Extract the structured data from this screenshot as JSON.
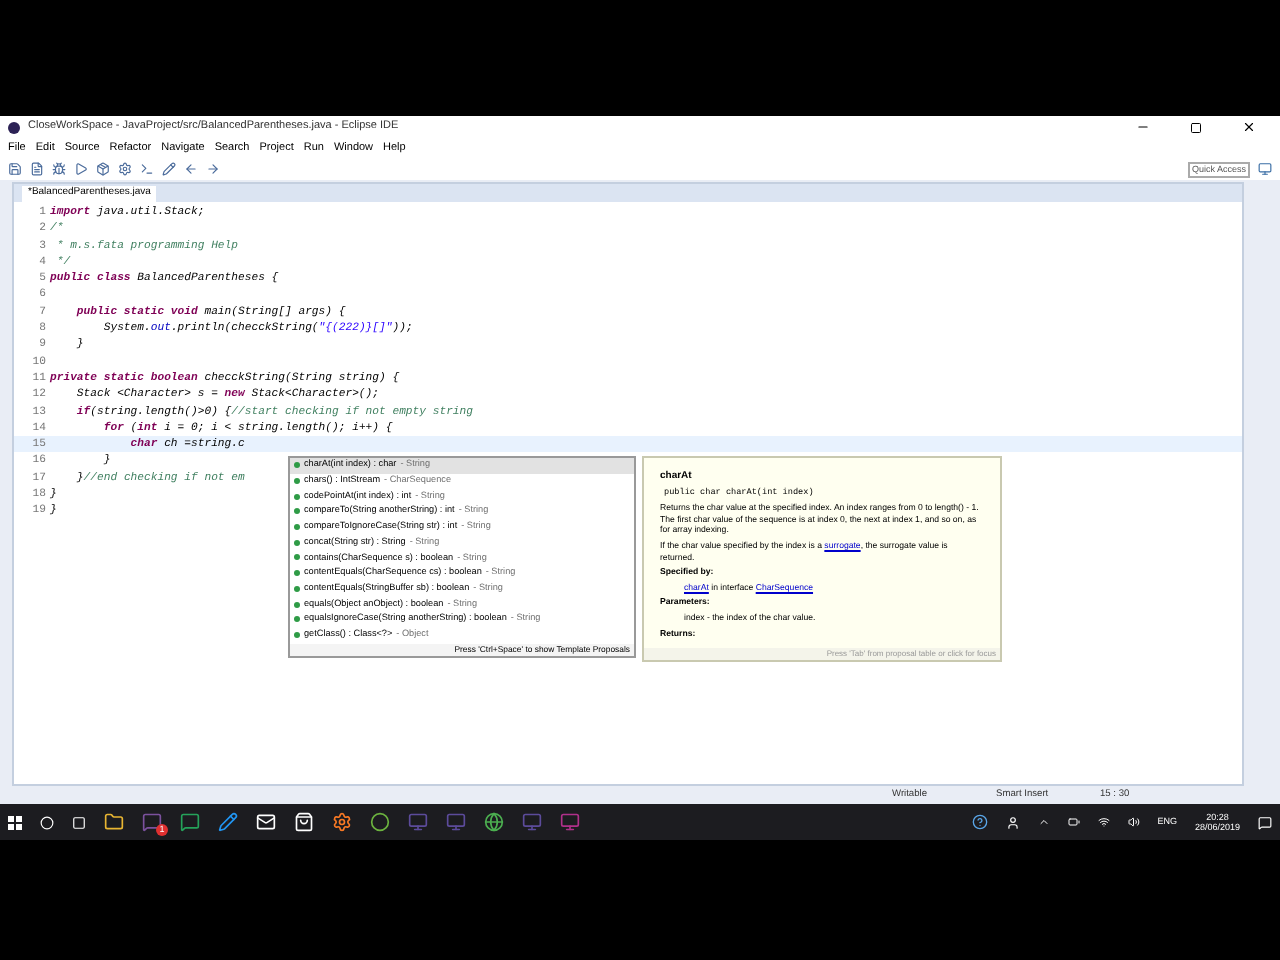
{
  "window": {
    "title": "CloseWorkSpace - JavaProject/src/BalancedParentheses.java - Eclipse IDE"
  },
  "menu": [
    "File",
    "Edit",
    "Source",
    "Refactor",
    "Navigate",
    "Search",
    "Project",
    "Run",
    "Window",
    "Help"
  ],
  "quick_access": {
    "placeholder": "Quick Access"
  },
  "editor_tab": {
    "label": "*BalancedParentheses.java",
    "selected": true
  },
  "code_lines": [
    {
      "number": "1",
      "current": false,
      "tokens": [
        {
          "kind": "keyword",
          "text": "import"
        },
        {
          "kind": "plain",
          "text": " java.util.Stack;"
        }
      ]
    },
    {
      "number": "2",
      "current": false,
      "tokens": [
        {
          "kind": "comment",
          "text": "/*"
        }
      ]
    },
    {
      "number": "3",
      "current": false,
      "tokens": [
        {
          "kind": "comment",
          "text": " * m.s.fata programming Help"
        }
      ]
    },
    {
      "number": "4",
      "current": false,
      "tokens": [
        {
          "kind": "comment",
          "text": " */"
        }
      ]
    },
    {
      "number": "5",
      "current": false,
      "tokens": [
        {
          "kind": "keyword",
          "text": "public class"
        },
        {
          "kind": "plain",
          "text": " BalancedParentheses {"
        }
      ]
    },
    {
      "number": "6",
      "current": false
    },
    {
      "number": "7",
      "current": false,
      "tokens": [
        {
          "kind": "keyword",
          "text": "    public static void"
        },
        {
          "kind": "plain",
          "text": " main(String[] args) {"
        }
      ]
    },
    {
      "number": "8",
      "current": false,
      "tokens": [
        {
          "kind": "plain",
          "text": "        System."
        },
        {
          "kind": "field",
          "text": "out"
        },
        {
          "kind": "plain",
          "text": ".println(checckString("
        },
        {
          "kind": "string",
          "text": "\"{(222)}[]\""
        },
        {
          "kind": "plain",
          "text": "));"
        }
      ]
    },
    {
      "number": "9",
      "current": false,
      "tokens": [
        {
          "kind": "plain",
          "text": "    }"
        }
      ]
    },
    {
      "number": "10",
      "current": false
    },
    {
      "number": "11",
      "current": false,
      "tokens": [
        {
          "kind": "keyword",
          "text": "private static boolean"
        },
        {
          "kind": "plain",
          "text": " checckString(String string) {"
        }
      ]
    },
    {
      "number": "12",
      "current": false,
      "tokens": [
        {
          "kind": "plain",
          "text": "    Stack <Character> s = "
        },
        {
          "kind": "keyword",
          "text": "new"
        },
        {
          "kind": "plain",
          "text": " Stack<Character>();"
        }
      ]
    },
    {
      "number": "13",
      "current": false,
      "tokens": [
        {
          "kind": "keyword",
          "text": "    if"
        },
        {
          "kind": "plain",
          "text": "(string.length()>0) {"
        },
        {
          "kind": "comment",
          "text": "//start checking if not empty string"
        }
      ]
    },
    {
      "number": "14",
      "current": false,
      "tokens": [
        {
          "kind": "keyword",
          "text": "        for"
        },
        {
          "kind": "plain",
          "text": " ("
        },
        {
          "kind": "keyword",
          "text": "int"
        },
        {
          "kind": "plain",
          "text": " i = 0; i < string.length(); i++) {"
        }
      ]
    },
    {
      "number": "15",
      "current": true,
      "tokens": [
        {
          "kind": "keyword",
          "text": "            char"
        },
        {
          "kind": "plain",
          "text": " ch =string.c"
        }
      ]
    },
    {
      "number": "16",
      "current": false,
      "tokens": [
        {
          "kind": "plain",
          "text": "        }"
        }
      ]
    },
    {
      "number": "17",
      "current": false,
      "tokens": [
        {
          "kind": "plain",
          "text": "    }"
        },
        {
          "kind": "comment",
          "text": "//end checking if not em"
        }
      ]
    },
    {
      "number": "18",
      "current": false,
      "tokens": [
        {
          "kind": "plain",
          "text": "}"
        }
      ]
    },
    {
      "number": "19",
      "current": false,
      "tokens": [
        {
          "kind": "plain",
          "text": "}"
        }
      ]
    }
  ],
  "proposals": [
    {
      "label": "charAt(int index) : char",
      "owner": "- String",
      "selected": true
    },
    {
      "label": "chars() : IntStream",
      "owner": "- CharSequence",
      "selected": false
    },
    {
      "label": "codePointAt(int index) : int",
      "owner": "- String",
      "selected": false
    },
    {
      "label": "compareTo(String anotherString) : int",
      "owner": "- String",
      "selected": false
    },
    {
      "label": "compareToIgnoreCase(String str) : int",
      "owner": "- String",
      "selected": false
    },
    {
      "label": "concat(String str) : String",
      "owner": "- String",
      "selected": false
    },
    {
      "label": "contains(CharSequence s) : boolean",
      "owner": "- String",
      "selected": false
    },
    {
      "label": "contentEquals(CharSequence cs) : boolean",
      "owner": "- String",
      "selected": false
    },
    {
      "label": "contentEquals(StringBuffer sb) : boolean",
      "owner": "- String",
      "selected": false
    },
    {
      "label": "equals(Object anObject) : boolean",
      "owner": "- String",
      "selected": false
    },
    {
      "label": "equalsIgnoreCase(String anotherString) : boolean",
      "owner": "- String",
      "selected": false
    },
    {
      "label": "getClass() : Class<?>",
      "owner": "- Object",
      "selected": false
    }
  ],
  "proposals_hint": "Press 'Ctrl+Space' to show Template Proposals",
  "doc": {
    "title": "charAt",
    "signature": "public char charAt(int index)",
    "paragraphs": [
      [
        {
          "text": "Returns the char value at the specified index. An index ranges from 0 to length() - 1. The first char value of the sequence is at index 0, the next at index 1, and so on, as for array indexing.",
          "kind": "text"
        }
      ],
      [
        {
          "text": "If the char value specified by the index is a ",
          "kind": "text"
        },
        {
          "text": "surrogate",
          "kind": "link"
        },
        {
          "text": ", the surrogate value is returned.",
          "kind": "text"
        }
      ]
    ],
    "specified_by_heading": "Specified by:",
    "specified_by": [
      {
        "text": "charAt",
        "kind": "link"
      },
      {
        "text": " in interface ",
        "kind": "text"
      },
      {
        "text": "CharSequence",
        "kind": "link"
      }
    ],
    "parameters_heading": "Parameters:",
    "parameters": "index - the index of the char value.",
    "returns_heading": "Returns:",
    "hint": "Press 'Tab' from proposal table or click for focus"
  },
  "status_bar": [
    "Writable",
    "Smart Insert",
    "15 : 30"
  ],
  "taskbar": {
    "badge": "1",
    "language": "ENG",
    "time": "20:28",
    "date": "28/06/2019"
  }
}
